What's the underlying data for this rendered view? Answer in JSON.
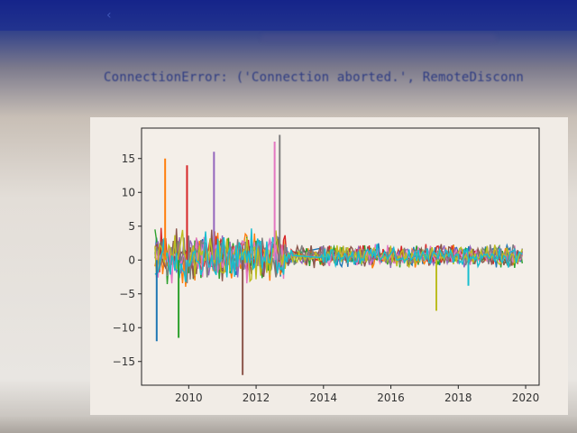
{
  "console": {
    "error_text": "ConnectionError: ('Connection aborted.', RemoteDisconn"
  },
  "colors": {
    "series": [
      "#1f77b4",
      "#ff7f0e",
      "#2ca02c",
      "#d62728",
      "#9467bd",
      "#8c564b",
      "#e377c2",
      "#7f7f7f",
      "#bcbd22",
      "#17becf"
    ]
  },
  "chart_data": {
    "type": "line",
    "title": "",
    "xlabel": "",
    "ylabel": "",
    "xlim": [
      2008.6,
      2020.4
    ],
    "ylim": [
      -18.5,
      19.5
    ],
    "grid": false,
    "xticks": [
      "2010",
      "2012",
      "2014",
      "2016",
      "2018",
      "2020"
    ],
    "yticks": [
      "15",
      "10",
      "5",
      "0",
      "−5",
      "−10",
      "−15"
    ],
    "series_count": 10,
    "x_start": 2009.0,
    "x_end": 2019.9,
    "highlights": [
      {
        "x": 2009.05,
        "y": -12
      },
      {
        "x": 2009.3,
        "y": 15
      },
      {
        "x": 2009.7,
        "y": -11.5
      },
      {
        "x": 2009.95,
        "y": 14
      },
      {
        "x": 2010.75,
        "y": 16
      },
      {
        "x": 2011.6,
        "y": -17
      },
      {
        "x": 2012.55,
        "y": 17.5
      },
      {
        "x": 2012.7,
        "y": 18.5
      },
      {
        "x": 2017.35,
        "y": -7.5
      },
      {
        "x": 2018.3,
        "y": -3.8
      }
    ]
  }
}
